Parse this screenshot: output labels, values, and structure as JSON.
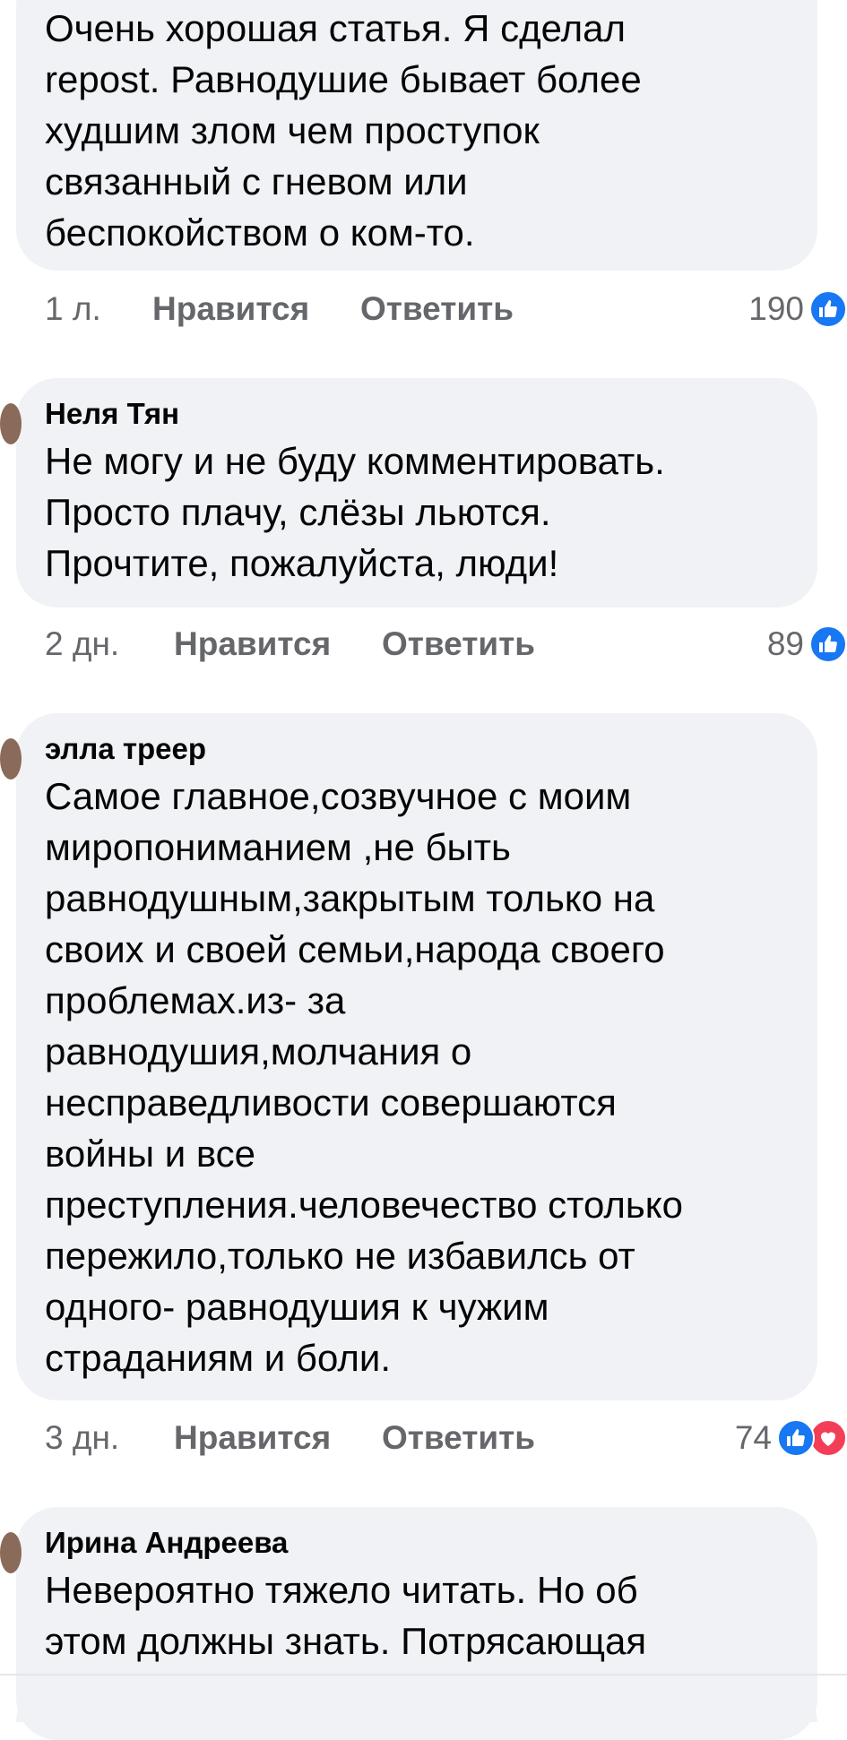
{
  "comments": [
    {
      "author": "",
      "text": "Очень хорошая статья. Я сделал\nrepost. Равнодушие бывает более\nхудшим злом чем проступок\nсвязанный с гневом или\nбеспокойством о ком-то.",
      "time": "1 л.",
      "like_label": "Нравится",
      "reply_label": "Ответить",
      "reaction_count": "190",
      "reactions": [
        "like-icon"
      ]
    },
    {
      "author": "Неля Тян",
      "text": "Не могу и не буду комментировать.\nПросто плачу, слёзы льются.\nПрочтите, пожалуйста,  люди!",
      "time": "2 дн.",
      "like_label": "Нравится",
      "reply_label": "Ответить",
      "reaction_count": "89",
      "reactions": [
        "like-icon"
      ]
    },
    {
      "author": "элла треер",
      "text": "Самое главное,созвучное с моим\nмиропониманием  ,не быть\nравнодушным,закрытым только на\nсвоих и своей семьи,народа своего\nпроблемах.из- за\nравнодушия,молчания о\nнесправедливости совершаются\nвойны и все\nпреступления.человечество столько\nпережило,только не избавилсь от\nодного- равнодушия к чужим\nстраданиям и боли.",
      "time": "3 дн.",
      "like_label": "Нравится",
      "reply_label": "Ответить",
      "reaction_count": "74",
      "reactions": [
        "like-icon",
        "heart-icon"
      ]
    },
    {
      "author": "Ирина Андреева",
      "text": "Невероятно тяжело читать. Но об\nэтом должны знать. Потрясающая"
    }
  ],
  "colors": {
    "bubble_bg": "#f0f2f5",
    "meta_text": "#65676b",
    "like_blue": "#1877f2",
    "love_red": "#f33e58"
  }
}
